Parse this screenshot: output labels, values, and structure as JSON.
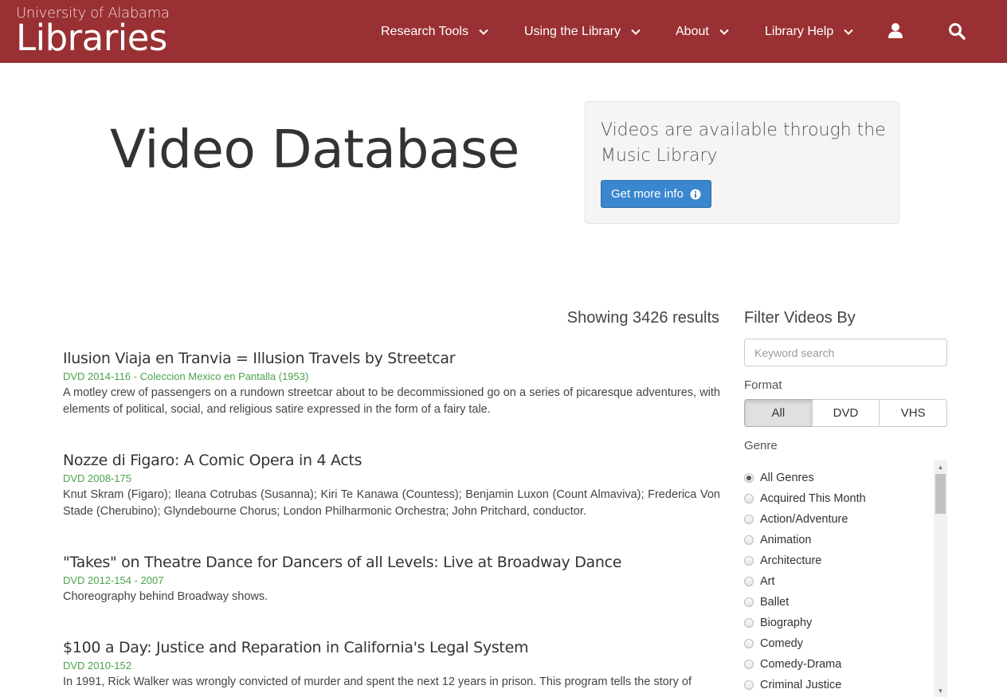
{
  "brand": {
    "line1": "University of Alabama",
    "line2": "Libraries"
  },
  "nav": {
    "items": [
      {
        "label": "Research Tools"
      },
      {
        "label": "Using the Library"
      },
      {
        "label": "About"
      },
      {
        "label": "Library Help"
      }
    ],
    "user_icon": "user-icon",
    "search_icon": "search-icon"
  },
  "hero": {
    "title": "Video Database",
    "notice": "Videos are available through the Music Library",
    "button_label": "Get more info",
    "button_icon": "info-circle-icon"
  },
  "results": {
    "count_text": "Showing 3426 results",
    "items": [
      {
        "title": "Ilusion Viaja en Tranvia = Illusion Travels by Streetcar",
        "call": "DVD 2014-116 - Coleccion Mexico en Pantalla (1953)",
        "desc": "A motley crew of passengers on a rundown streetcar about to be decommissioned go on a series of picaresque adventures, with elements of political, social, and religious satire expressed in the form of a fairy tale."
      },
      {
        "title": "Nozze di Figaro: A Comic Opera in 4 Acts",
        "call": "DVD 2008-175",
        "desc": "Knut Skram (Figaro); Ileana Cotrubas (Susanna); Kiri Te Kanawa (Countess); Benjamin Luxon (Count Almaviva); Frederica Von Stade (Cherubino); Glyndebourne Chorus; London Philharmonic Orchestra; John Pritchard, conductor."
      },
      {
        "title": "\"Takes\" on Theatre Dance for Dancers of all Levels: Live at Broadway Dance",
        "call": "DVD 2012-154 - 2007",
        "desc": "Choreography behind Broadway shows."
      },
      {
        "title": "$100 a Day: Justice and Reparation in California's Legal System",
        "call": "DVD 2010-152",
        "desc": "In 1991, Rick Walker was wrongly convicted of murder and spent the next 12 years in prison. This program tells the story of"
      }
    ]
  },
  "filters": {
    "title": "Filter Videos By",
    "keyword_placeholder": "Keyword search",
    "format_label": "Format",
    "formats": [
      "All",
      "DVD",
      "VHS"
    ],
    "selected_format": "All",
    "genre_label": "Genre",
    "genres": [
      "All Genres",
      "Acquired This Month",
      "Action/Adventure",
      "Animation",
      "Architecture",
      "Art",
      "Ballet",
      "Biography",
      "Comedy",
      "Comedy-Drama",
      "Criminal Justice"
    ],
    "selected_genre": "All Genres"
  },
  "colors": {
    "header": "#993033",
    "button": "#3a87cf",
    "call_number": "#4ba34b"
  }
}
